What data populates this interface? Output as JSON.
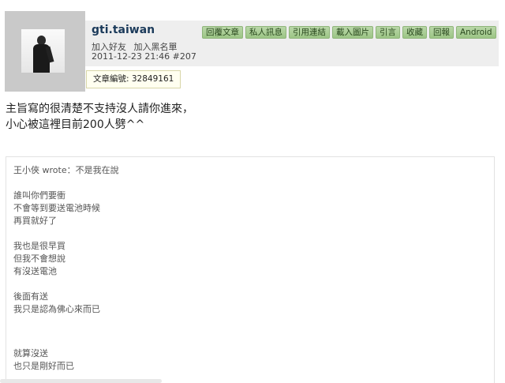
{
  "author": {
    "name": "gti.taiwan",
    "add_friend": "加入好友",
    "add_blacklist": "加入黑名單",
    "timestamp": "2011-12-23 21:46",
    "floor": "#207"
  },
  "actions": [
    "回覆文章",
    "私人訊息",
    "引用連結",
    "載入圖片",
    "引言",
    "收藏",
    "回報",
    "Android"
  ],
  "tooltip": {
    "text": "文章編號: 32849161"
  },
  "post": {
    "lines": [
      "主旨寫的很清楚不支持沒人請你進來，",
      "小心被這裡目前200人劈^^"
    ]
  },
  "quote": {
    "header": "王小俠 wrote：不是我在說",
    "blocks": [
      [
        "誰叫你們要衝",
        "不會等到要送電池時候",
        "再買就好了"
      ],
      [
        "我也是很早買",
        "但我不會想說",
        "有沒送電池"
      ],
      [
        "後面有送",
        "我只是認為佛心來而已"
      ],
      [
        "就算沒送",
        "也只是剛好而已"
      ]
    ]
  },
  "colors": {
    "header_bg": "#eeeeee",
    "button_green": "#a8cf94",
    "username": "#1b3a5a",
    "tooltip_bg": "#fffff0"
  }
}
